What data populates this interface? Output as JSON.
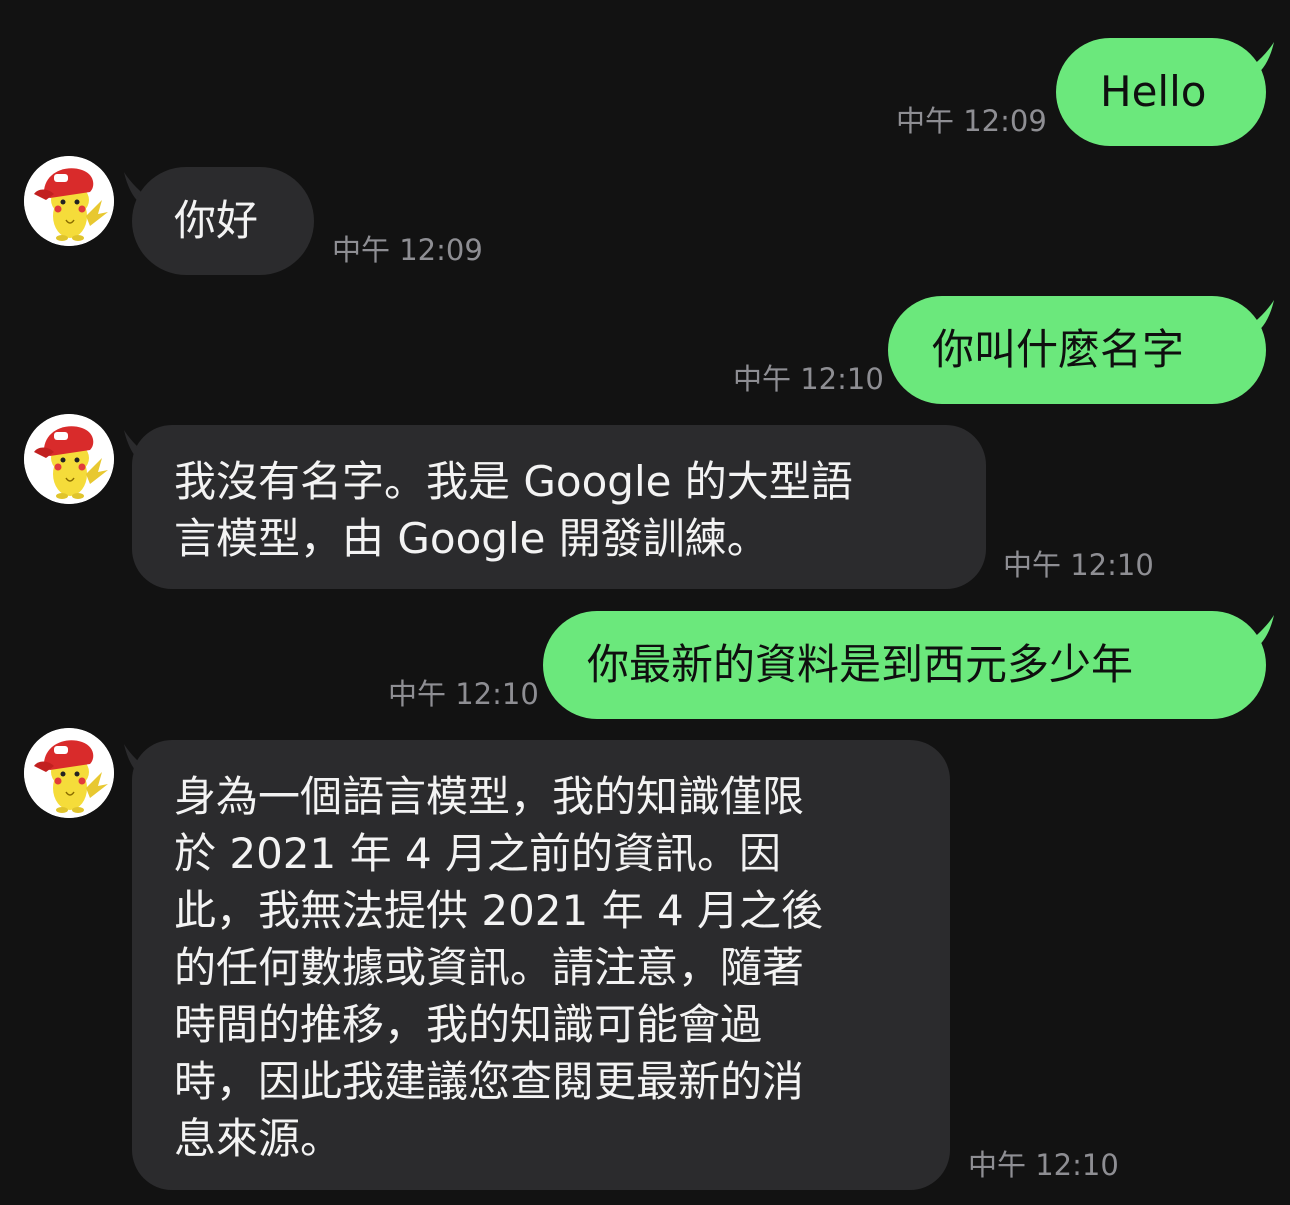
{
  "colors": {
    "background": "#121212",
    "sent_bubble": "#6be87c",
    "received_bubble": "#2b2b2d",
    "timestamp": "#8e8e93"
  },
  "messages": [
    {
      "direction": "sent",
      "text": "Hello",
      "time": "中午 12:09"
    },
    {
      "direction": "received",
      "avatar": "pikachu-avatar-icon",
      "text": "你好",
      "time": "中午 12:09"
    },
    {
      "direction": "sent",
      "text": "你叫什麼名字",
      "time": "中午 12:10"
    },
    {
      "direction": "received",
      "avatar": "pikachu-avatar-icon",
      "lines": [
        "我沒有名字。我是 Google 的大型語",
        "言模型，由 Google 開發訓練。"
      ],
      "time": "中午 12:10"
    },
    {
      "direction": "sent",
      "text": "你最新的資料是到西元多少年",
      "time": "中午 12:10"
    },
    {
      "direction": "received",
      "avatar": "pikachu-avatar-icon",
      "lines": [
        "身為一個語言模型，我的知識僅限",
        "於 2021 年 4 月之前的資訊。因",
        "此，我無法提供 2021 年 4 月之後",
        "的任何數據或資訊。請注意，隨著",
        "時間的推移，我的知識可能會過",
        "時，因此我建議您查閱更最新的消",
        "息來源。"
      ],
      "time": "中午 12:10"
    }
  ]
}
